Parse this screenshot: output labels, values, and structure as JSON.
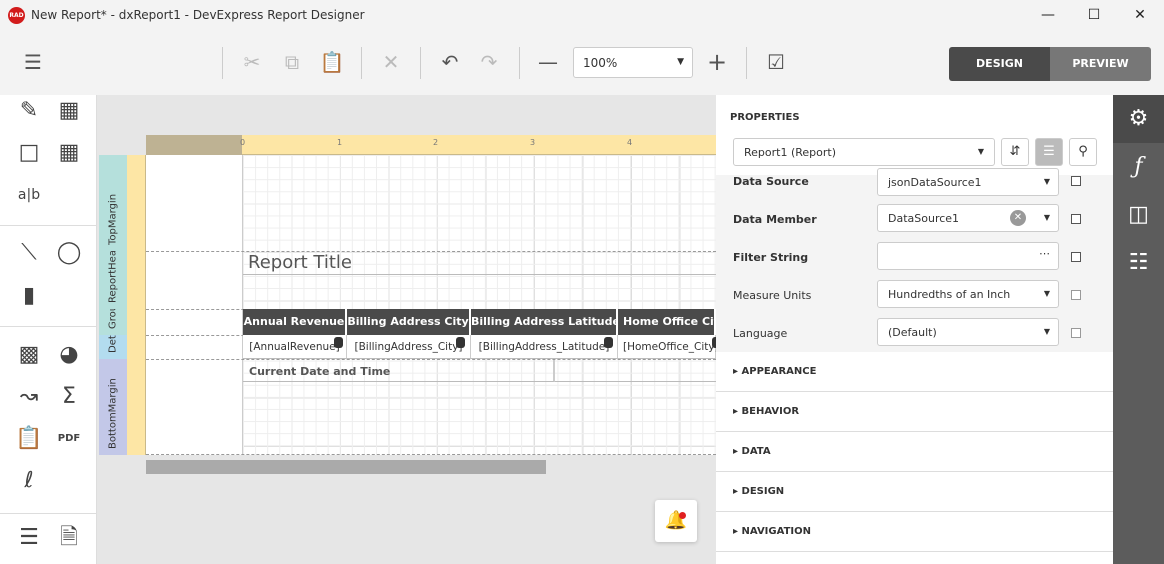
{
  "window": {
    "title": "New Report* - dxReport1 - DevExpress Report Designer",
    "logo": "RAD"
  },
  "toolbar": {
    "zoom": "100%",
    "design": "DESIGN",
    "preview": "PREVIEW"
  },
  "ruler": {
    "numbers": [
      "0",
      "1",
      "2",
      "3",
      "4"
    ]
  },
  "bands": [
    "TopMargin",
    "ReportHeader",
    "GroupHeader",
    "Detail",
    "BottomMargin"
  ],
  "report": {
    "title": "Report Title",
    "headers": [
      "Annual Revenue",
      "Billing Address City",
      "Billing Address Latitude",
      "Home Office City"
    ],
    "fields": [
      "[AnnualRevenue]",
      "[BillingAddress_City]",
      "[BillingAddress_Latitude]",
      "[HomeOffice_City]"
    ],
    "footer": "Current Date and Time"
  },
  "properties": {
    "heading": "PROPERTIES",
    "selected": "Report1 (Report)",
    "rows": [
      {
        "label": "Data Source",
        "value": "jsonDataSource1"
      },
      {
        "label": "Data Member",
        "value": "DataSource1"
      },
      {
        "label": "Filter String",
        "value": ""
      },
      {
        "label": "Measure Units",
        "value": "Hundredths of an Inch"
      },
      {
        "label": "Language",
        "value": "(Default)"
      }
    ],
    "sections": [
      "APPEARANCE",
      "BEHAVIOR",
      "DATA",
      "DESIGN",
      "NAVIGATION"
    ]
  },
  "colors": {
    "accent_dark": "#4a4a4a",
    "ruler": "#fde6a5",
    "sidebar": "#5c5c5c"
  }
}
